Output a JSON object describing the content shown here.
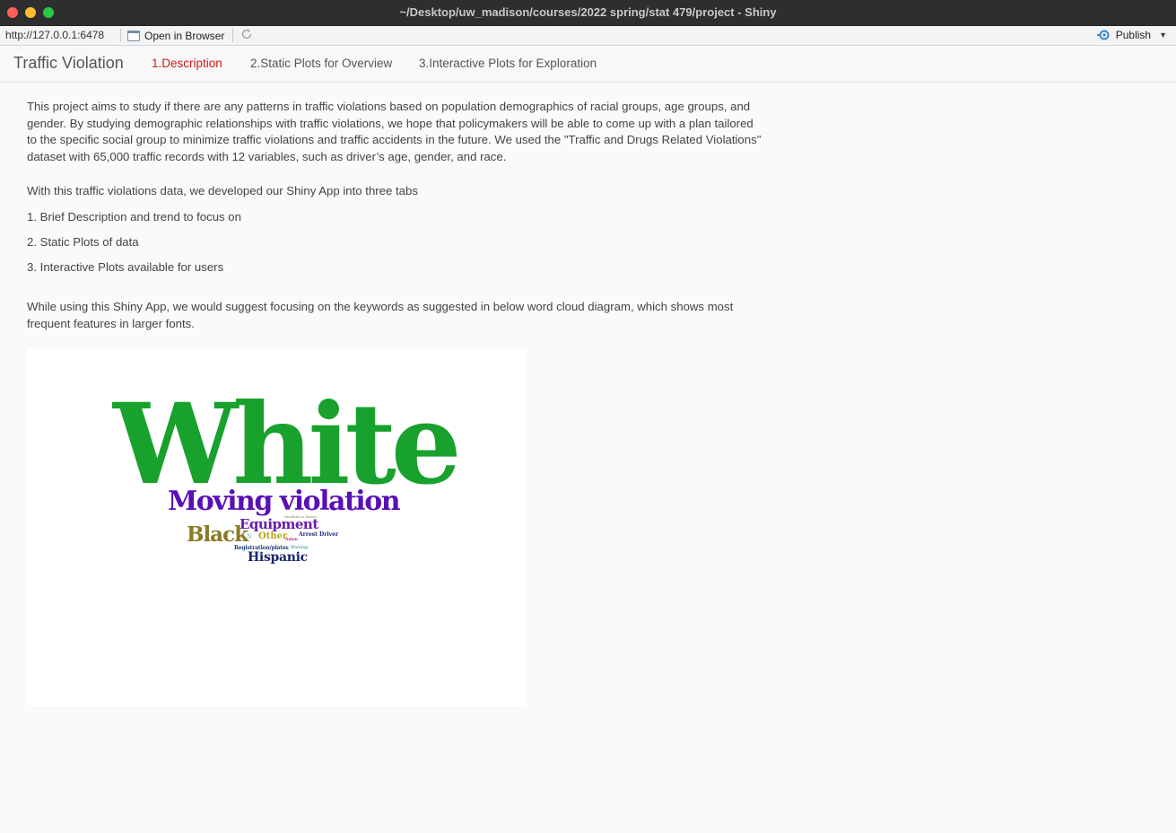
{
  "window": {
    "title": "~/Desktop/uw_madison/courses/2022 spring/stat 479/project - Shiny"
  },
  "viewer_toolbar": {
    "url": "http://127.0.0.1:6478",
    "open_in_browser": "Open in Browser",
    "publish": "Publish"
  },
  "navbar": {
    "brand": "Traffic Violation",
    "tabs": [
      {
        "label": "1.Description",
        "active": true
      },
      {
        "label": "2.Static Plots for Overview",
        "active": false
      },
      {
        "label": "3.Interactive Plots for Exploration",
        "active": false
      }
    ]
  },
  "content": {
    "intro": "This project aims to study if there are any patterns in traffic violations based on population demographics of racial groups, age groups, and gender. By studying demographic relationships with traffic violations, we hope that policymakers will be able to come up with a plan tailored to the specific social group to minimize traffic violations and traffic accidents in the future. We used the \"Traffic and Drugs Related Violations\" dataset with 65,000 traffic records with 12 variables, such as driver’s age, gender, and race.",
    "tabs_intro": "With this traffic violations data, we developed our Shiny App into three tabs",
    "list": [
      "1. Brief Description and trend to focus on",
      "2. Static Plots of data",
      "3. Interactive Plots available for users"
    ],
    "cloud_intro": "While using this Shiny App, we would suggest focusing on the keywords as suggested in below word cloud diagram, which shows most frequent features in larger fonts."
  },
  "word_cloud": {
    "words": [
      {
        "text": "White",
        "color": "#18a12c"
      },
      {
        "text": "Moving violation",
        "color": "#5a0fb5"
      },
      {
        "text": "Equipment",
        "color": "#6a1ba8"
      },
      {
        "text": "Black",
        "color": "#8a7a25"
      },
      {
        "text": "Other",
        "color": "#b8a515"
      },
      {
        "text": "Arrest Driver",
        "color": "#1f2a7a"
      },
      {
        "text": "Hispanic",
        "color": "#1c2470"
      },
      {
        "text": "Registration/plates",
        "color": "#1f3f7a"
      },
      {
        "text": "Incident to Arrest",
        "color": "#7a8a3a"
      },
      {
        "text": "Warning",
        "color": "#1a8a8a"
      },
      {
        "text": "Asian",
        "color": "#d0208a"
      },
      {
        "text": "N",
        "color": "#7ab0c8"
      }
    ]
  }
}
